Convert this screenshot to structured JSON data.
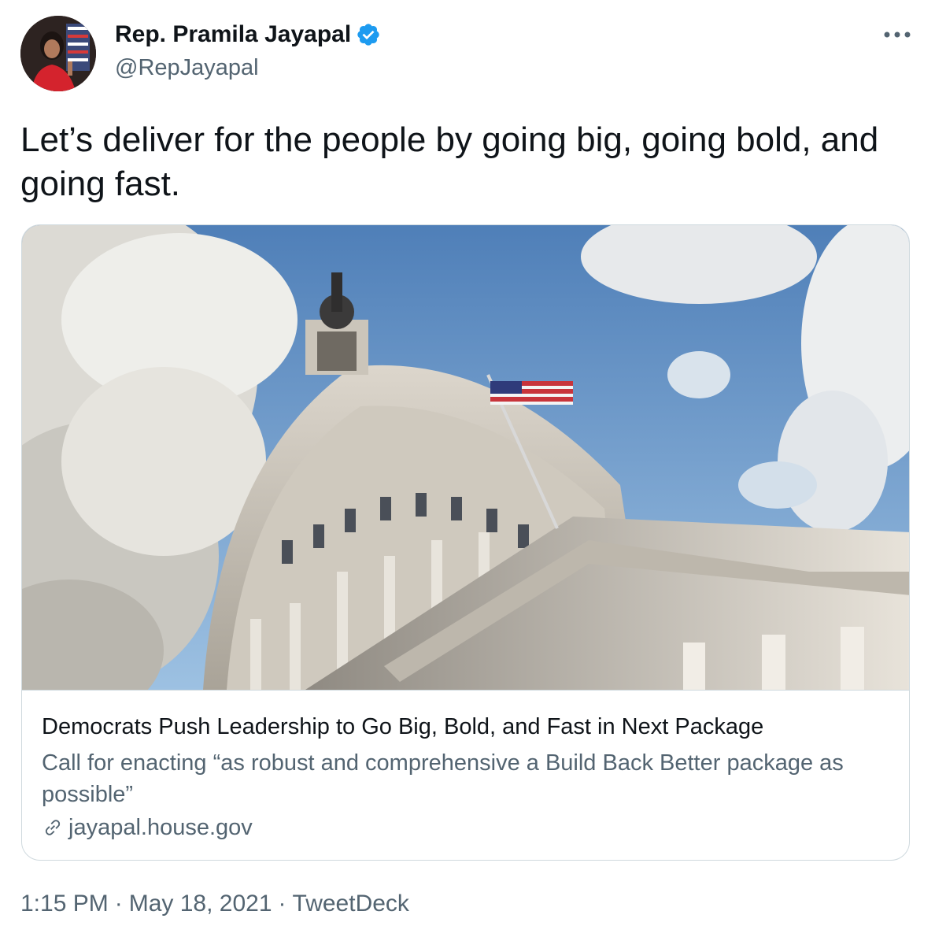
{
  "author": {
    "name": "Rep. Pramila Jayapal",
    "handle": "@RepJayapal",
    "verified": true
  },
  "tweet": {
    "text": "Let’s deliver for the people by going big, going bold, and going fast."
  },
  "card": {
    "title": "Democrats Push Leadership to Go Big, Bold, and Fast in Next Package",
    "description": "Call for enacting “as robust and comprehensive a Build Back Better package as possible”",
    "domain": "jayapal.house.gov"
  },
  "meta": {
    "time": "1:15 PM",
    "separator": "·",
    "date": "May 18, 2021",
    "source": "TweetDeck"
  },
  "icons": [
    "avatar",
    "verified-badge-icon",
    "more-options-icon",
    "link-icon"
  ],
  "colors": {
    "verified": "#1d9bf0",
    "text": "#0f1419",
    "secondary": "#536471",
    "border": "#cfd9de"
  }
}
